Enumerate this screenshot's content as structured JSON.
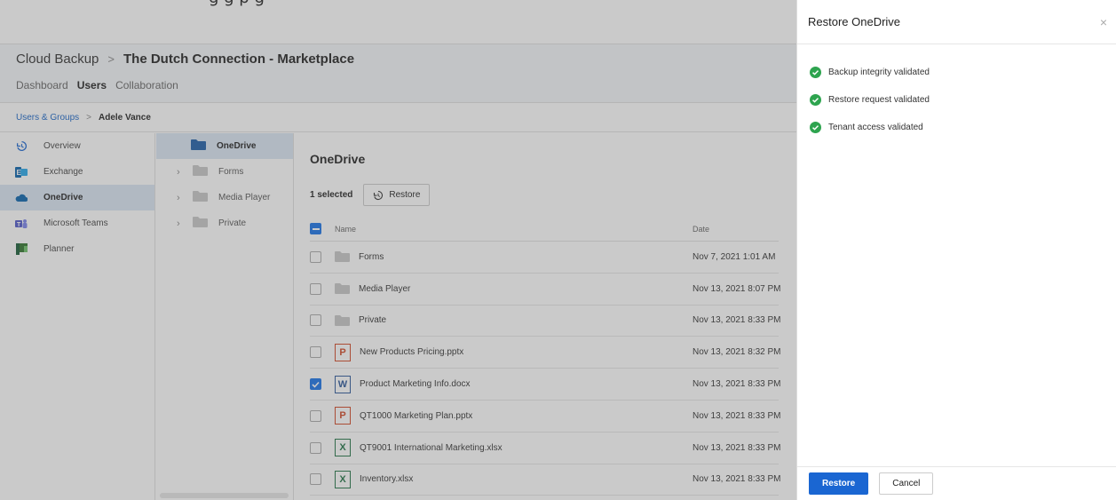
{
  "cut_heading": "g                   g   p   g",
  "header": {
    "app_title": "Cloud Backup",
    "separator": ">",
    "org_title": "The Dutch Connection - Marketplace",
    "tabs": [
      {
        "label": "Dashboard",
        "active": false
      },
      {
        "label": "Users",
        "active": true
      },
      {
        "label": "Collaboration",
        "active": false
      }
    ]
  },
  "breadcrumb": {
    "root": "Users & Groups",
    "separator": ">",
    "current": "Adele Vance"
  },
  "sidebar": {
    "items": [
      {
        "label": "Overview",
        "icon": "history-icon"
      },
      {
        "label": "Exchange",
        "icon": "exchange-icon"
      },
      {
        "label": "OneDrive",
        "icon": "onedrive-icon",
        "active": true
      },
      {
        "label": "Microsoft Teams",
        "icon": "teams-icon"
      },
      {
        "label": "Planner",
        "icon": "planner-icon"
      }
    ]
  },
  "tree": {
    "root": "OneDrive",
    "children": [
      "Forms",
      "Media Player",
      "Private"
    ]
  },
  "content": {
    "title": "OneDrive",
    "selected_count": "1 selected",
    "restore_label": "Restore",
    "columns": {
      "name": "Name",
      "date": "Date"
    },
    "rows": [
      {
        "name": "Forms",
        "type": "folder",
        "date": "Nov 7, 2021 1:01 AM",
        "checked": false
      },
      {
        "name": "Media Player",
        "type": "folder",
        "date": "Nov 13, 2021 8:07 PM",
        "checked": false
      },
      {
        "name": "Private",
        "type": "folder",
        "date": "Nov 13, 2021 8:33 PM",
        "checked": false
      },
      {
        "name": "New Products Pricing.pptx",
        "type": "pptx",
        "date": "Nov 13, 2021 8:32 PM",
        "checked": false
      },
      {
        "name": "Product Marketing Info.docx",
        "type": "docx",
        "date": "Nov 13, 2021 8:33 PM",
        "checked": true
      },
      {
        "name": "QT1000 Marketing Plan.pptx",
        "type": "pptx",
        "date": "Nov 13, 2021 8:33 PM",
        "checked": false
      },
      {
        "name": "QT9001 International Marketing.xlsx",
        "type": "xlsx",
        "date": "Nov 13, 2021 8:33 PM",
        "checked": false
      },
      {
        "name": "Inventory.xlsx",
        "type": "xlsx",
        "date": "Nov 13, 2021 8:33 PM",
        "checked": false
      }
    ]
  },
  "panel": {
    "title": "Restore OneDrive",
    "close": "×",
    "checks": [
      "Backup integrity validated",
      "Restore request validated",
      "Tenant access validated"
    ],
    "primary": "Restore",
    "secondary": "Cancel"
  },
  "colors": {
    "accent": "#1a66d2",
    "success": "#2ea44f",
    "active_bg": "#dbe6f3"
  }
}
